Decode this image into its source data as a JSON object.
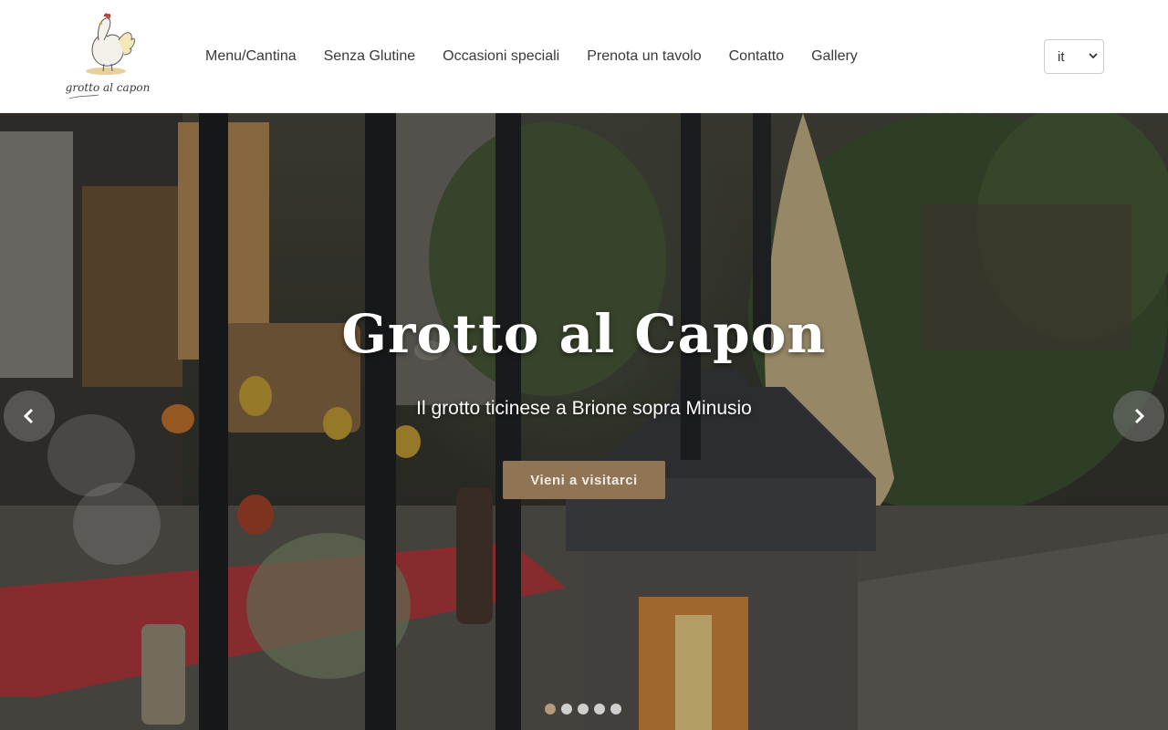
{
  "brand": {
    "logo_text": "grotto al capon"
  },
  "nav": {
    "items": [
      {
        "label": "Menu/Cantina"
      },
      {
        "label": "Senza Glutine"
      },
      {
        "label": "Occasioni speciali"
      },
      {
        "label": "Prenota un tavolo"
      },
      {
        "label": "Contatto"
      },
      {
        "label": "Gallery"
      }
    ]
  },
  "language": {
    "selected": "it"
  },
  "hero": {
    "title": "Grotto al Capon",
    "subtitle": "Il grotto ticinese a Brione sopra Minusio",
    "button_label": "Vieni a visitarci",
    "slides_total": 5,
    "active_slide": 1
  },
  "colors": {
    "accent": "#8f7455",
    "active_dot": "#b39a7c",
    "nav_text": "#3a3a3a"
  },
  "icons": {
    "prev": "chevron-left-icon",
    "next": "chevron-right-icon",
    "select": "chevron-down-icon"
  }
}
